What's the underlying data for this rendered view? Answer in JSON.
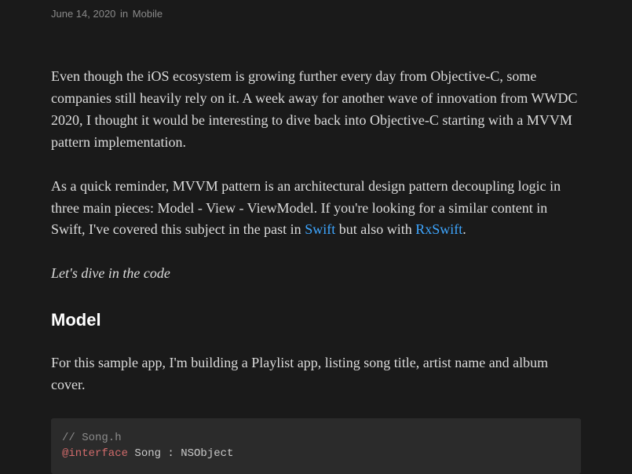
{
  "meta": {
    "date": "June 14, 2020",
    "in": "in",
    "category": "Mobile"
  },
  "paragraphs": {
    "intro": "Even though the iOS ecosystem is growing further every day from Objective-C, some companies still heavily rely on it. A week away for another wave of innovation from WWDC 2020, I thought it would be interesting to dive back into Objective-C starting with a MVVM pattern implementation.",
    "reminder_pre": "As a quick reminder, MVVM pattern is an architectural design pattern decoupling logic in three main pieces: Model - View - ViewModel. If you're looking for a similar content in Swift, I've covered this subject in the past in ",
    "link_swift": "Swift",
    "reminder_mid": " but also with ",
    "link_rxswift": "RxSwift",
    "reminder_end": ".",
    "dive": "Let's dive in the code",
    "sample": "For this sample app, I'm building a Playlist app, listing song title, artist name and album cover."
  },
  "headings": {
    "model": "Model"
  },
  "code": {
    "comment": "// Song.h",
    "keyword": "@interface",
    "rest": " Song : NSObject"
  }
}
